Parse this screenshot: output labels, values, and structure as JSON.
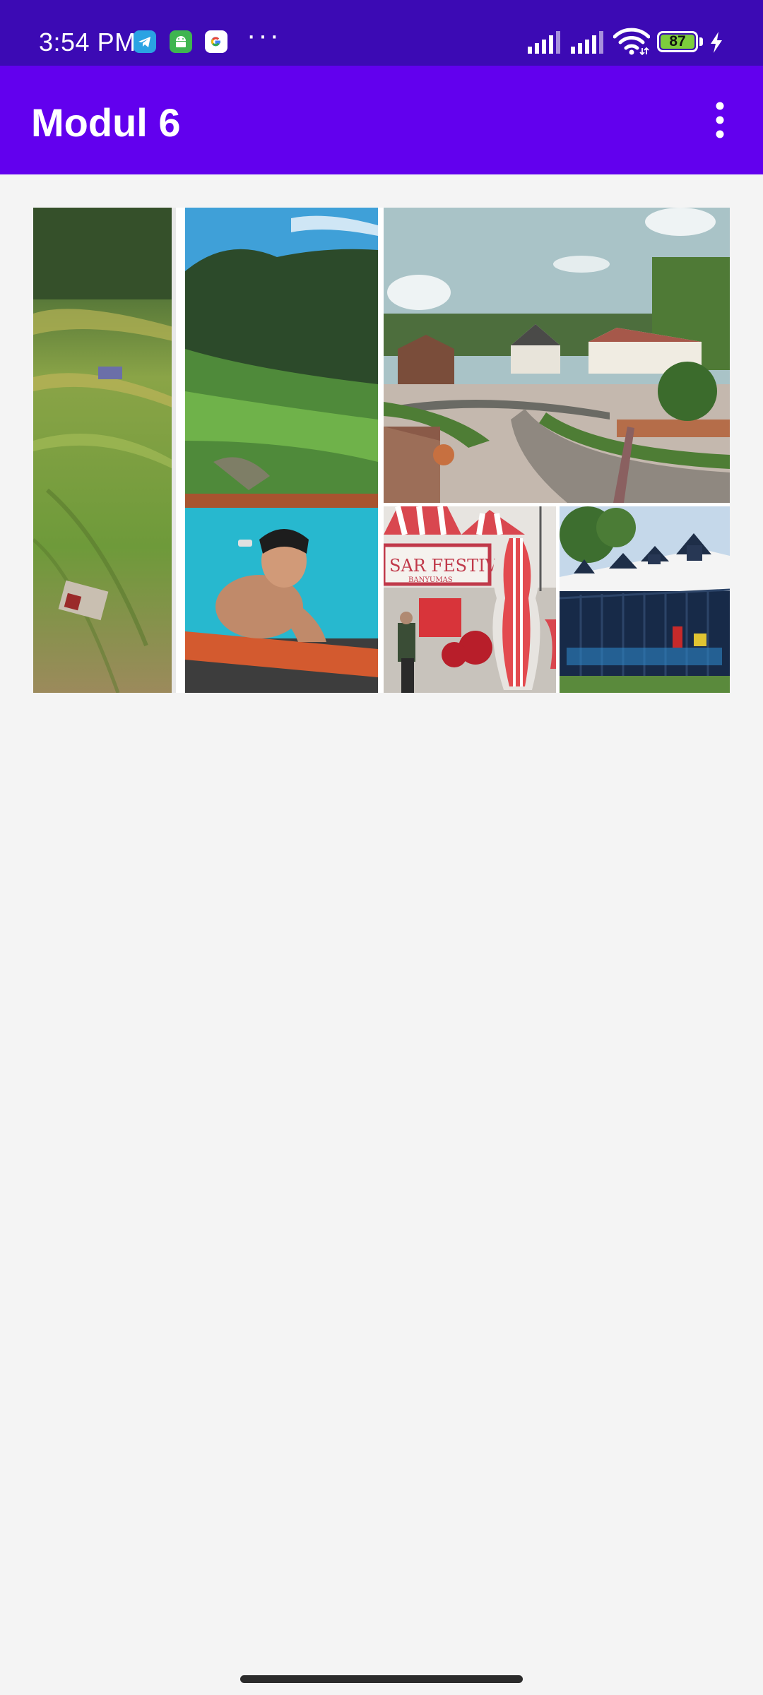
{
  "status_bar": {
    "time": "3:54 PM",
    "more_indicator": "···",
    "battery_level": "87",
    "notification_icons": [
      "telegram-icon",
      "android-icon",
      "google-icon"
    ],
    "status_icons": [
      "signal-icon",
      "signal-icon",
      "wifi-icon",
      "battery-icon",
      "charging-icon"
    ]
  },
  "app_bar": {
    "title": "Modul 6",
    "overflow_icon": "more-vert-icon"
  },
  "colors": {
    "status_bar": "#3c0ab4",
    "app_bar": "#6200ee",
    "background": "#f4f4f4"
  },
  "gallery": {
    "sign_text": "SAR FESTIVAL",
    "sign_subtext": "BANYUMAS"
  }
}
